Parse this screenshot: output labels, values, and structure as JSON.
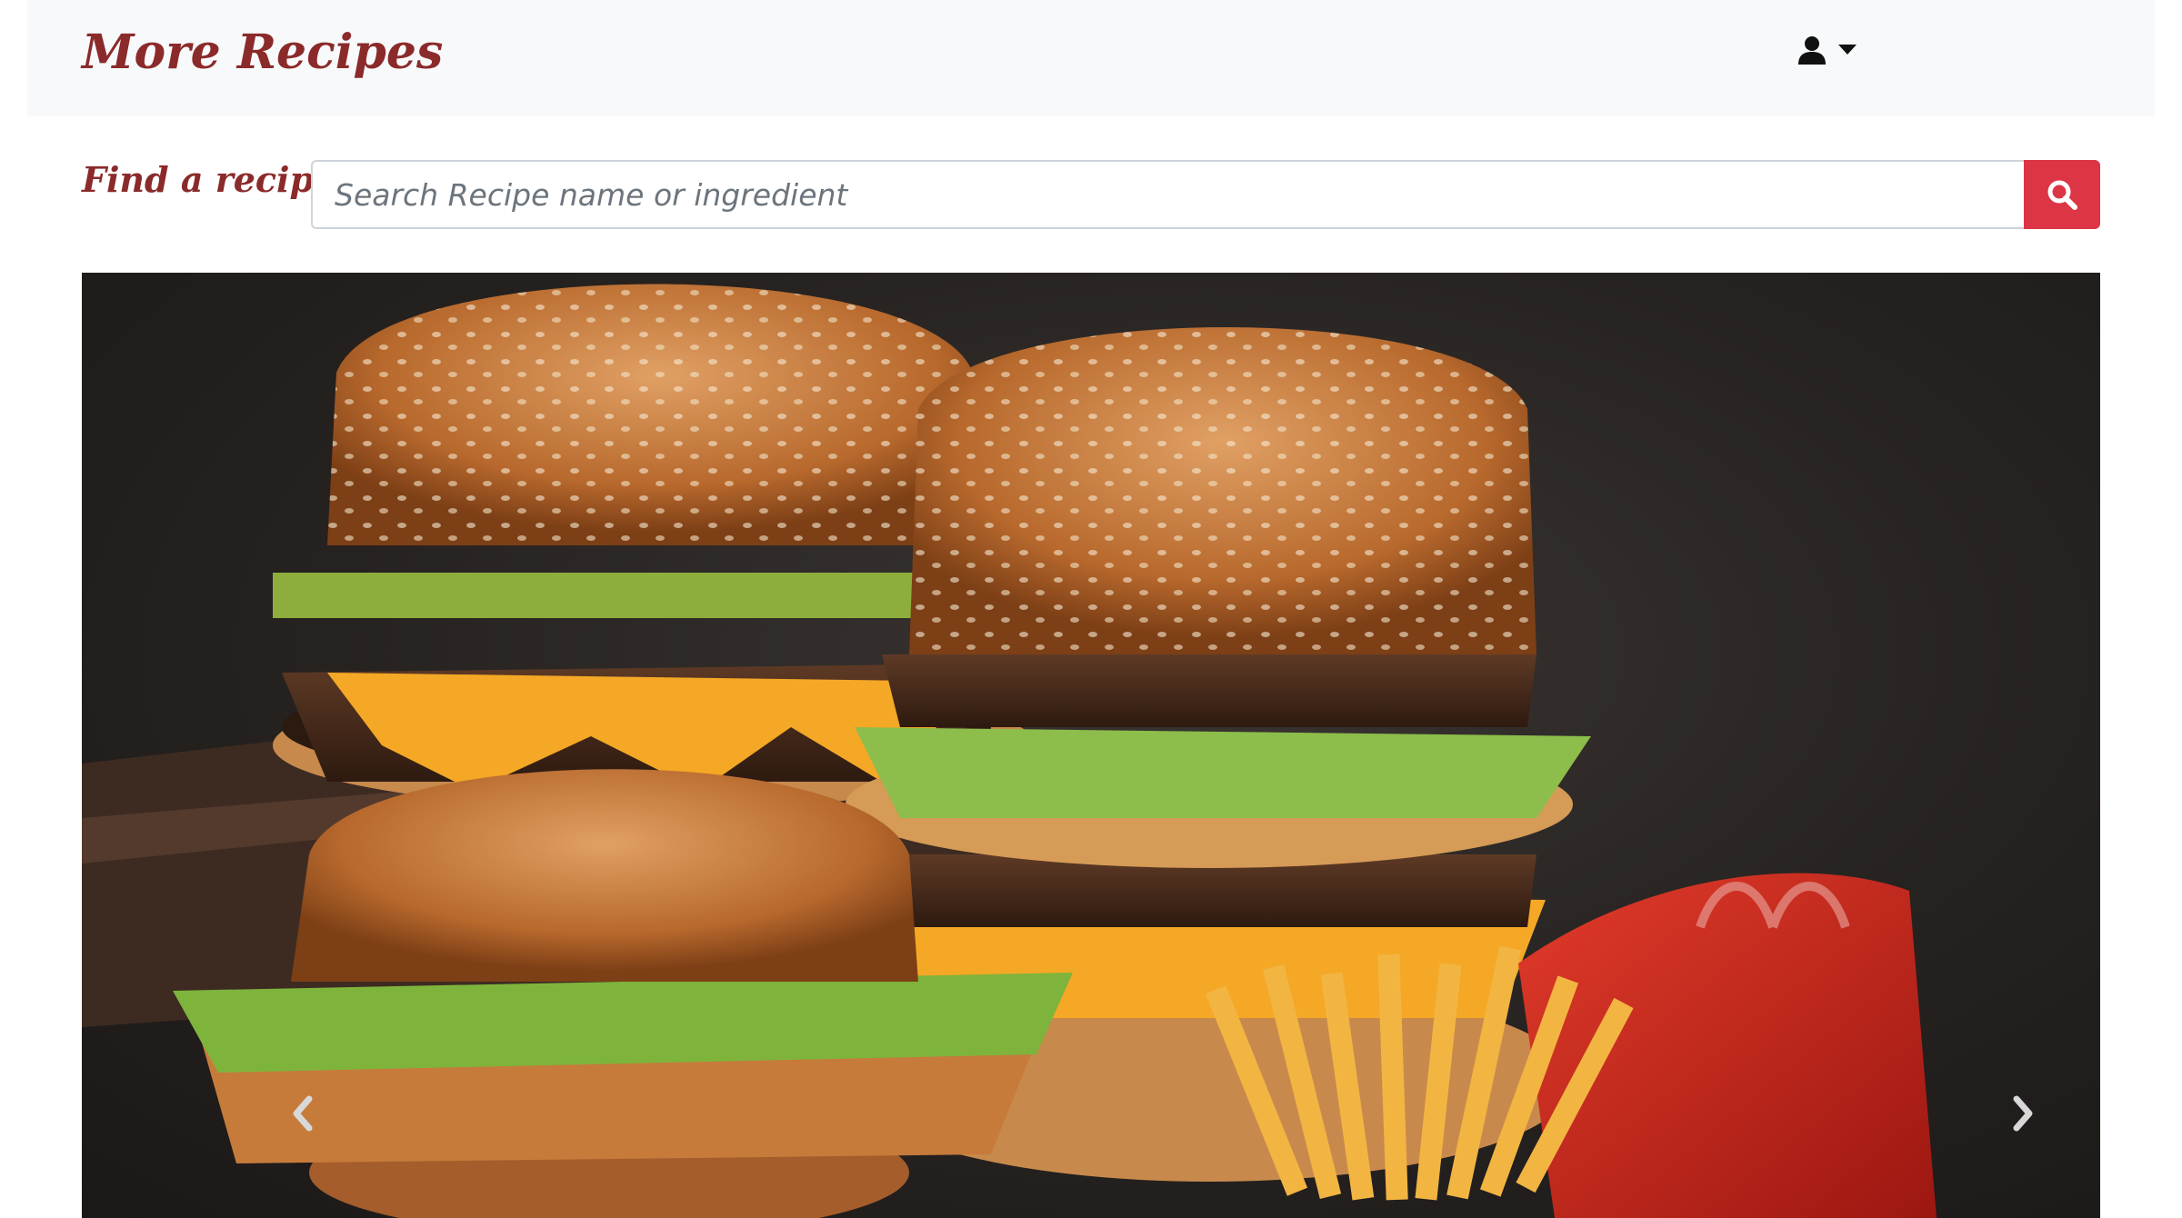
{
  "app": {
    "brand": "More Recipes"
  },
  "navbar": {
    "user_icon": "user-icon",
    "dropdown_icon": "caret-down-icon"
  },
  "search": {
    "label": "Find a recipe:",
    "placeholder": "Search Recipe name or ingredient",
    "value": "",
    "button_icon": "search-icon"
  },
  "carousel": {
    "prev_icon": "chevron-left-icon",
    "next_icon": "chevron-right-icon",
    "image_description_icon": "burger-meal-photo"
  },
  "colors": {
    "brand": "#8b2a2a",
    "search_button": "#dc3545",
    "navbar_bg": "#f8f9fa"
  }
}
